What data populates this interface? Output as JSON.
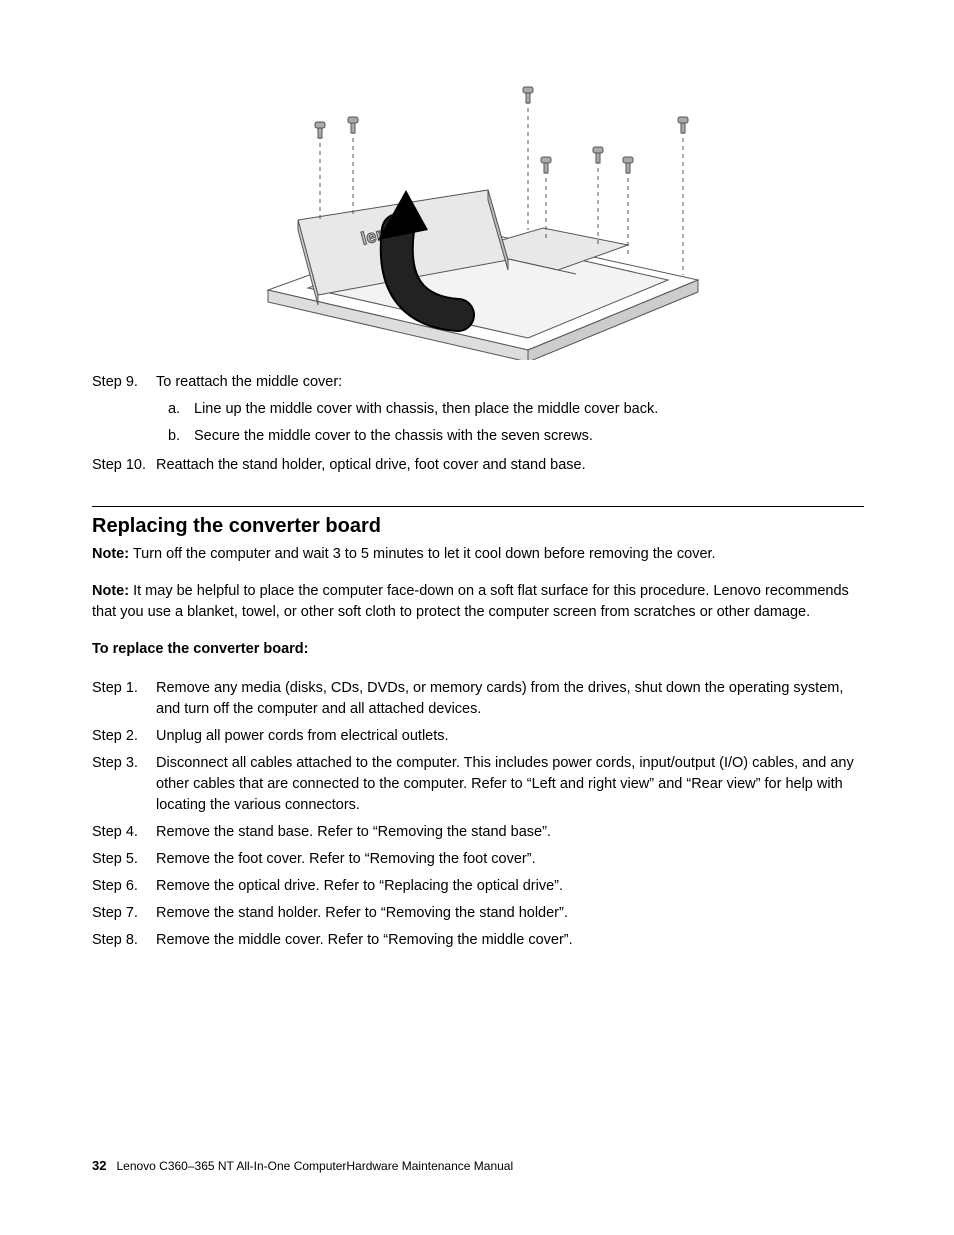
{
  "figure": {
    "alt": "Line drawing of a Lenovo all-in-one computer lying face-down with the middle cover being lifted. A large curved arrow indicates the cover rotating up from the chassis. Seven screws with dashed vertical lines show screw locations above the cover.",
    "logo_text": "lenovo"
  },
  "top_steps": [
    {
      "label": "Step 9.",
      "text": "To reattach the middle cover:",
      "subs": [
        {
          "label": "a.",
          "text": "Line up the middle cover with chassis, then place the middle cover back."
        },
        {
          "label": "b.",
          "text": "Secure the middle cover to the chassis with the seven screws."
        }
      ]
    },
    {
      "label": "Step 10.",
      "text": "Reattach the stand holder, optical drive, foot cover and stand base.",
      "subs": []
    }
  ],
  "section": {
    "heading": "Replacing the converter board",
    "note1_label": "Note:",
    "note1_text": " Turn off the computer and wait 3 to 5 minutes to let it cool down before removing the cover.",
    "note2_label": "Note:",
    "note2_text": " It may be helpful to place the computer face-down on a soft flat surface for this procedure. Lenovo recommends that you use a blanket, towel, or other soft cloth to protect the computer screen from scratches or other damage.",
    "sub_heading": "To replace the converter board:",
    "steps": [
      {
        "label": "Step 1.",
        "text": "Remove any media (disks, CDs, DVDs, or memory cards) from the drives, shut down the operating system, and turn off the computer and all attached devices."
      },
      {
        "label": "Step 2.",
        "text": "Unplug all power cords from electrical outlets."
      },
      {
        "label": "Step 3.",
        "text": "Disconnect all cables attached to the computer. This includes power cords, input/output (I/O) cables, and any other cables that are connected to the computer. Refer to “Left and right view” and “Rear view” for help with locating the various connectors."
      },
      {
        "label": "Step 4.",
        "text": "Remove the stand base. Refer to “Removing the stand base”."
      },
      {
        "label": "Step 5.",
        "text": "Remove the foot cover. Refer to “Removing the foot cover”."
      },
      {
        "label": "Step 6.",
        "text": "Remove the optical drive. Refer to “Replacing the optical drive”."
      },
      {
        "label": "Step 7.",
        "text": "Remove the stand holder. Refer to “Removing the stand holder”."
      },
      {
        "label": "Step 8.",
        "text": "Remove the middle cover. Refer to “Removing the middle cover”."
      }
    ]
  },
  "footer": {
    "page_number": "32",
    "doc_title": "Lenovo C360–365 NT All-In-One ComputerHardware Maintenance Manual"
  }
}
